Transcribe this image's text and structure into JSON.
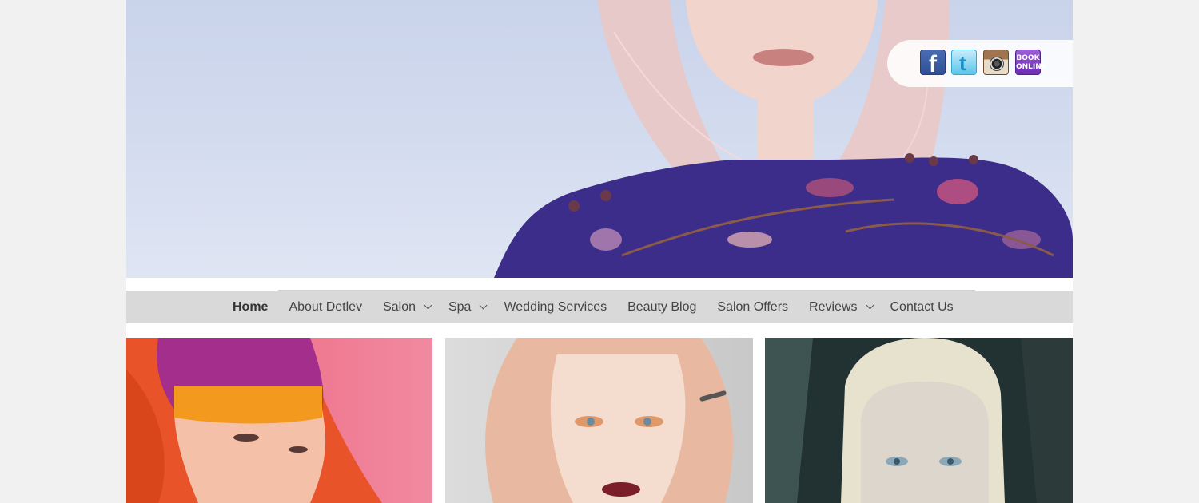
{
  "hero": {
    "image": "woman-with-pink-hair-floral-blouse"
  },
  "social": {
    "icons": [
      "facebook-icon",
      "twitter-icon",
      "instagram-icon",
      "book-online-icon"
    ],
    "facebook_glyph": "f",
    "twitter_glyph": "t",
    "book_line1": "BOOK",
    "book_line2": "ONLINE"
  },
  "nav": {
    "items": [
      {
        "label": "Home",
        "active": true,
        "submenu": false
      },
      {
        "label": "About Detlev",
        "submenu": false
      },
      {
        "label": "Salon",
        "submenu": true
      },
      {
        "label": "Spa",
        "submenu": true
      },
      {
        "label": "Wedding Services",
        "submenu": false
      },
      {
        "label": "Beauty Blog",
        "submenu": false
      },
      {
        "label": "Salon Offers",
        "submenu": false
      },
      {
        "label": "Reviews",
        "submenu": true
      },
      {
        "label": "Contact Us",
        "submenu": false
      }
    ]
  },
  "gallery": {
    "tiles": [
      "orange-pink-hair-model",
      "blonde-wavy-hair-model",
      "platinum-slicked-hair-model"
    ]
  },
  "colors": {
    "page_bg": "#f1f1f1",
    "nav_bg": "#d9d9d9",
    "nav_text": "#444444"
  }
}
